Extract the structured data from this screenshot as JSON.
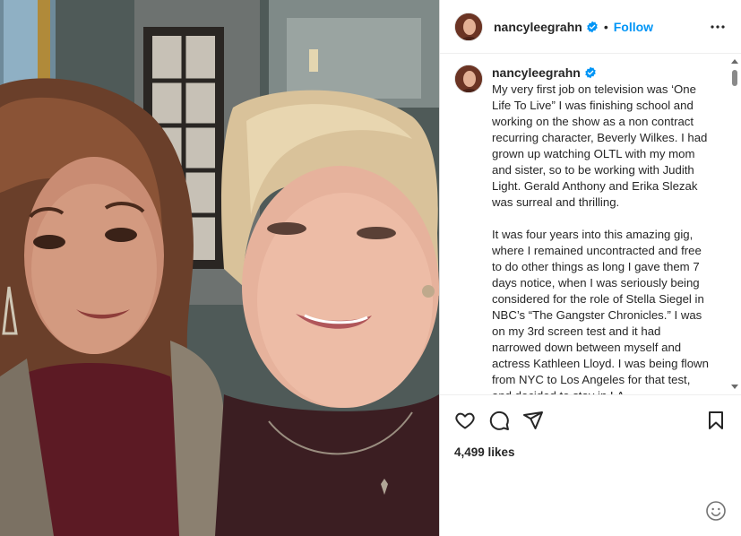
{
  "post": {
    "username": "nancyleegrahn",
    "separator": "•",
    "follow_label": "Follow",
    "caption_paragraphs": [
      "My very first job on television was ‘One Life To Live” I was finishing school and working on the show as a non contract recurring character, Beverly Wilkes. I had grown up watching OLTL with my mom and sister, so to be working with Judith Light. Gerald Anthony and Erika Slezak was surreal and thrilling.",
      "It was four years into this amazing gig, where I remained uncontracted and free to do other things as long I gave them 7 days notice, when I was seriously being considered for the role of Stella Siegel in NBC’s “The Gangster Chronicles.” I was on my 3rd screen test and it had narrowed down between myself and actress Kathleen Lloyd. I was being flown from NYC to Los Angeles for that test, and decided to stay in LA"
    ],
    "likes_text": "4,499 likes",
    "comment_placeholder": ""
  },
  "icons": {
    "verified": "verified-badge-icon",
    "more": "more-options-icon",
    "like": "heart-icon",
    "comment": "comment-icon",
    "share": "share-icon",
    "save": "bookmark-icon",
    "emoji": "emoji-icon"
  },
  "colors": {
    "accent": "#0095f6",
    "text": "#262626",
    "border": "#dbdbdb"
  }
}
